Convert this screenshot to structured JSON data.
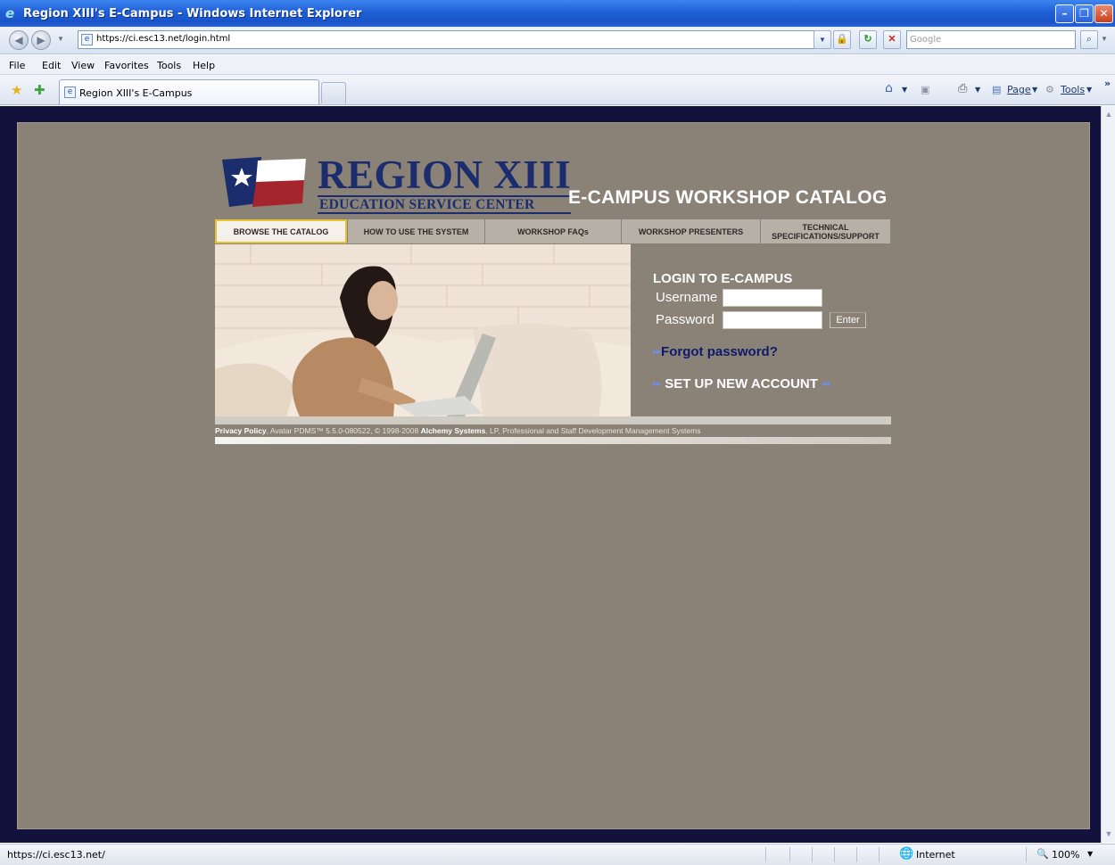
{
  "window": {
    "title": "Region XIII's E-Campus - Windows Internet Explorer",
    "minimize_glyph": "–",
    "restore_glyph": "❐",
    "close_glyph": "✕"
  },
  "address_bar": {
    "url": "https://ci.esc13.net/login.html",
    "search_placeholder": "Google"
  },
  "menu": [
    "File",
    "Edit",
    "View",
    "Favorites",
    "Tools",
    "Help"
  ],
  "tab": {
    "title": "Region XIII's E-Campus"
  },
  "command_bar": {
    "page_label": "Page",
    "tools_label": "Tools"
  },
  "header": {
    "logo_main": "REGION XIII",
    "logo_sub": "EDUCATION SERVICE CENTER",
    "catalog_title": "E-CAMPUS WORKSHOP CATALOG"
  },
  "nav_tabs": [
    "BROWSE THE CATALOG",
    "HOW TO USE THE SYSTEM",
    "WORKSHOP FAQs",
    "WORKSHOP PRESENTERS",
    "TECHNICAL SPECIFICATIONS/SUPPORT"
  ],
  "login": {
    "heading": "LOGIN TO E-CAMPUS",
    "username_label": "Username",
    "password_label": "Password",
    "enter_label": "Enter",
    "forgot_label": "Forgot password?",
    "new_account_label": "SET UP NEW ACCOUNT"
  },
  "footer": {
    "privacy_label": "Privacy Policy",
    "text_part1": ", Avatar PDMS™ 5.5.0-080522, © 1998-2008 ",
    "alchemy_label": "Alchemy Systems",
    "text_part2": ", LP, Professional and Staff Development Management Systems"
  },
  "status_bar": {
    "url": "https://ci.esc13.net/",
    "zone": "Internet",
    "zoom": "100%"
  },
  "colors": {
    "page_background": "#8a8277",
    "viewport_frame": "#13123c",
    "logo_blue": "#1c2d6e",
    "active_tab_border": "#e8c235",
    "forgot_link": "#0d1b6b"
  }
}
